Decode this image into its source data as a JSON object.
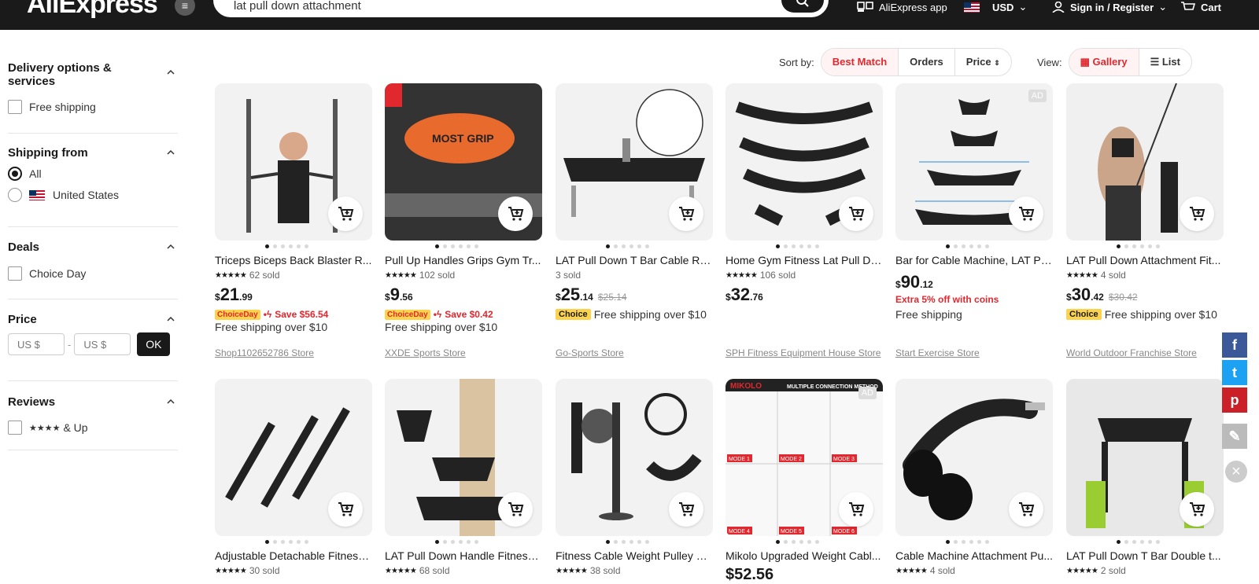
{
  "header": {
    "logo": "AliExpress",
    "search_value": "lat pull down attachment",
    "app_label": "AliExpress app",
    "currency": "USD",
    "signin": "Sign in / Register",
    "cart": "Cart"
  },
  "sidebar": {
    "delivery": {
      "title": "Delivery options & services",
      "options": [
        "Free shipping"
      ]
    },
    "shipping_from": {
      "title": "Shipping from",
      "options": [
        "All",
        "United States"
      ],
      "selected": "All"
    },
    "deals": {
      "title": "Deals",
      "options": [
        "Choice Day"
      ]
    },
    "price": {
      "title": "Price",
      "min_placeholder": "US $",
      "max_placeholder": "US $",
      "dash": "-",
      "ok": "OK"
    },
    "reviews": {
      "title": "Reviews",
      "option": "& Up",
      "stars": "★★★★"
    }
  },
  "sort": {
    "label": "Sort by:",
    "options": [
      "Best Match",
      "Orders",
      "Price"
    ],
    "active": "Best Match"
  },
  "view": {
    "label": "View:",
    "options": [
      "Gallery",
      "List"
    ],
    "active": "Gallery"
  },
  "products_row1": [
    {
      "title": "Triceps Biceps Back Blaster R...",
      "sold": "62 sold",
      "cur": "$",
      "int": "21",
      "dec": ".99",
      "old": "",
      "promo": "Save $56.54",
      "badge": "ChoiceDay",
      "ship": "Free shipping over $10",
      "choice": "",
      "store": "Shop1102652786 Store",
      "extra": "",
      "ad": ""
    },
    {
      "title": "Pull Up Handles Grips Gym Tr...",
      "sold": "102 sold",
      "cur": "$",
      "int": "9",
      "dec": ".56",
      "old": "",
      "promo": "Save $0.42",
      "badge": "ChoiceDay",
      "ship": "Free shipping over $10",
      "choice": "",
      "store": "XXDE Sports Store",
      "extra": "",
      "ad": ""
    },
    {
      "title": "LAT Pull Down T Bar Cable Ro...",
      "sold": "3 sold",
      "cur": "$",
      "int": "25",
      "dec": ".14",
      "old": "$25.14",
      "promo": "",
      "badge": "",
      "ship": "Free shipping over $10",
      "choice": "Choice",
      "store": "Go-Sports Store",
      "extra": "",
      "ad": ""
    },
    {
      "title": "Home Gym Fitness Lat Pull Do...",
      "sold": "106 sold",
      "cur": "$",
      "int": "32",
      "dec": ".76",
      "old": "",
      "promo": "",
      "badge": "",
      "ship": "",
      "choice": "",
      "store": "SPH Fitness Equipment House Store",
      "extra": "",
      "ad": ""
    },
    {
      "title": "Bar for Cable Machine, LAT Pu...",
      "sold": "",
      "cur": "$",
      "int": "90",
      "dec": ".12",
      "old": "",
      "promo": "",
      "badge": "",
      "ship": "Free shipping",
      "choice": "",
      "store": "Start Exercise Store",
      "extra": "Extra 5% off with coins",
      "ad": "AD"
    },
    {
      "title": "LAT Pull Down Attachment Fit...",
      "sold": "4 sold",
      "cur": "$",
      "int": "30",
      "dec": ".42",
      "old": "$30.42",
      "promo": "",
      "badge": "",
      "ship": "Free shipping over $10",
      "choice": "Choice",
      "store": "World Outdoor Franchise Store",
      "extra": "",
      "ad": ""
    }
  ],
  "products_row2": [
    {
      "title": "Adjustable Detachable Fitness...",
      "sold": "30 sold",
      "price": ""
    },
    {
      "title": "LAT Pull Down Handle Fitness ...",
      "sold": "68 sold",
      "price": ""
    },
    {
      "title": "Fitness Cable Weight Pulley Sy...",
      "sold": "38 sold",
      "price": ""
    },
    {
      "title": "Mikolo Upgraded Weight Cabl...",
      "sold": "",
      "price": "$52.56",
      "ad": "AD"
    },
    {
      "title": "Cable Machine Attachment Pu...",
      "sold": "4 sold",
      "price": ""
    },
    {
      "title": "LAT Pull Down T Bar Double t...",
      "sold": "2 sold",
      "price": ""
    }
  ],
  "mikolo_banner": "MIKOLO",
  "mikolo_caption": "MULTIPLE CONNECTION METHOD",
  "mikolo_modes": [
    "MODE 1",
    "MODE 2",
    "MODE 3",
    "MODE 4",
    "MODE 5",
    "MODE 6"
  ],
  "mostgrip_label": "MOST GRIP",
  "colors": {
    "accent": "#e0282e",
    "choice_yellow": "#fcd34d",
    "header_bg": "#1a1a1a"
  }
}
